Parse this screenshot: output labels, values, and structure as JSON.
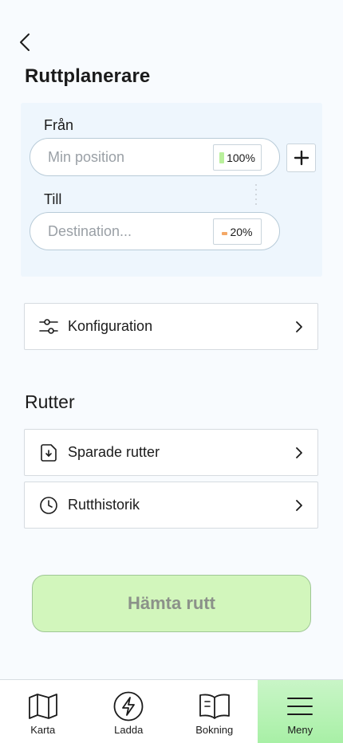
{
  "header": {
    "back_icon": "chevron-left-icon",
    "title": "Ruttplanerare"
  },
  "planner": {
    "from": {
      "label": "Från",
      "placeholder": "Min position",
      "battery": "100%",
      "battery_level": 1.0,
      "battery_color": "#b9f09c"
    },
    "to": {
      "label": "Till",
      "placeholder": "Destination...",
      "battery": "20%",
      "battery_level": 0.2,
      "battery_color": "#f4a866"
    },
    "add_icon": "plus-icon",
    "drag_icon": "drag-handle-icon"
  },
  "config": {
    "icon": "sliders-icon",
    "label": "Konfiguration",
    "chevron": "chevron-right-icon"
  },
  "routes": {
    "title": "Rutter",
    "items": [
      {
        "icon": "saved-file-icon",
        "label": "Sparade rutter"
      },
      {
        "icon": "clock-icon",
        "label": "Rutthistorik"
      }
    ]
  },
  "action": {
    "label": "Hämta rutt",
    "color": "#d2f6bc"
  },
  "tabbar": {
    "tabs": [
      {
        "icon": "map-icon",
        "label": "Karta"
      },
      {
        "icon": "lightning-icon",
        "label": "Ladda"
      },
      {
        "icon": "book-icon",
        "label": "Bokning"
      },
      {
        "icon": "menu-icon",
        "label": "Meny",
        "active": true
      }
    ],
    "active_color": "#a8f0a6"
  }
}
